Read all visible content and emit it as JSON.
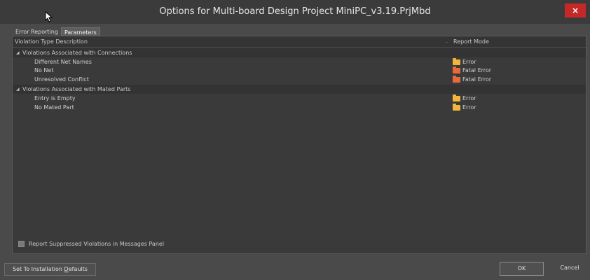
{
  "window": {
    "title": "Options for Multi-board Design Project MiniPC_v3.19.PrjMbd",
    "close_glyph": "×"
  },
  "tabs": [
    {
      "label": "Error Reporting"
    },
    {
      "label": "Parameters"
    }
  ],
  "grid": {
    "columns": {
      "description": "Violation Type Description",
      "mode": "Report Mode"
    },
    "groups": [
      {
        "label": "Violations Associated with Connections",
        "items": [
          {
            "label": "Different Net Names",
            "mode": "Error",
            "mode_icon": "folder-yellow"
          },
          {
            "label": "No Net",
            "mode": "Fatal Error",
            "mode_icon": "folder-orange"
          },
          {
            "label": "Unresolved Conflict",
            "mode": "Fatal Error",
            "mode_icon": "folder-orange"
          }
        ]
      },
      {
        "label": "Violations Associated with Mated Parts",
        "items": [
          {
            "label": "Entry is Empty",
            "mode": "Error",
            "mode_icon": "folder-yellow"
          },
          {
            "label": "No Mated Part",
            "mode": "Error",
            "mode_icon": "folder-yellow"
          }
        ]
      }
    ]
  },
  "footer": {
    "report_suppressed_label": "Report Suppressed Violations in Messages Panel",
    "report_suppressed_checked": false
  },
  "buttons": {
    "defaults_pre": "Set To Installation ",
    "defaults_underlined": "D",
    "defaults_post": "efaults",
    "ok": "OK",
    "cancel": "Cancel"
  },
  "colors": {
    "error_folder": "#f2b53a",
    "fatal_folder": "#e86a3c",
    "close_button": "#c62828"
  }
}
